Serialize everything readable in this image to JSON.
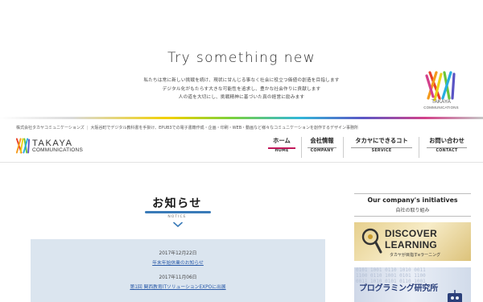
{
  "hero": {
    "tagline": "Try something new",
    "lines": [
      "私たちは常に新しい挑戦を続け、現状に甘んじる事なく社会に役立つ価値の創造を目指します",
      "デジタル化がもたらす大きな可能性を追求し、豊かな社会作りに貢献します",
      "人の道を大切にし、挑戦精神に基づいた真の経営に励みます"
    ],
    "logo": {
      "name": "TAKAYA",
      "sub": "COMMUNICATIONS"
    }
  },
  "header": {
    "company": "株式会社タカヤコミュニケーションズ",
    "description": "大阪谷町でデジタル教科書を手掛け、EPUB3での電子書籍作成・企画・印刷・WEB・動画など様々なコミュニケーションを創作するデザイン事務所",
    "brand": {
      "name": "TAKAYA",
      "sub": "COMMUNICATIONS"
    },
    "nav": [
      {
        "jp": "ホーム",
        "en": "HOME"
      },
      {
        "jp": "会社情報",
        "en": "COMPANY"
      },
      {
        "jp": "タカヤにできるコト",
        "en": "SERVICE"
      },
      {
        "jp": "お問い合わせ",
        "en": "CONTACT"
      }
    ]
  },
  "notice": {
    "title": "お知らせ",
    "subtitle": "NOTICE",
    "items": [
      {
        "date": "2017年12月22日",
        "title": "年末年始休業のお知らせ"
      },
      {
        "date": "2017年11月06日",
        "title": "第1回 関西教育ITソリューションEXPOに出展"
      }
    ]
  },
  "sidebar": {
    "title": "Our company's initiatives",
    "subtitle": "自社の取り組み",
    "banners": {
      "discover": {
        "line1": "DISCOVER",
        "line2": "LEARNING",
        "caption": "タカヤが目指すeラーニング",
        "icon": "magnifier-icon"
      },
      "programming": {
        "label": "プログラミング研究所",
        "icon": "robot-icon"
      }
    }
  },
  "colors": {
    "accent": "#c2185b",
    "link": "#2a5aa8",
    "notice_bar": "#3a7bb8",
    "news_bg": "#dbe5ef"
  }
}
